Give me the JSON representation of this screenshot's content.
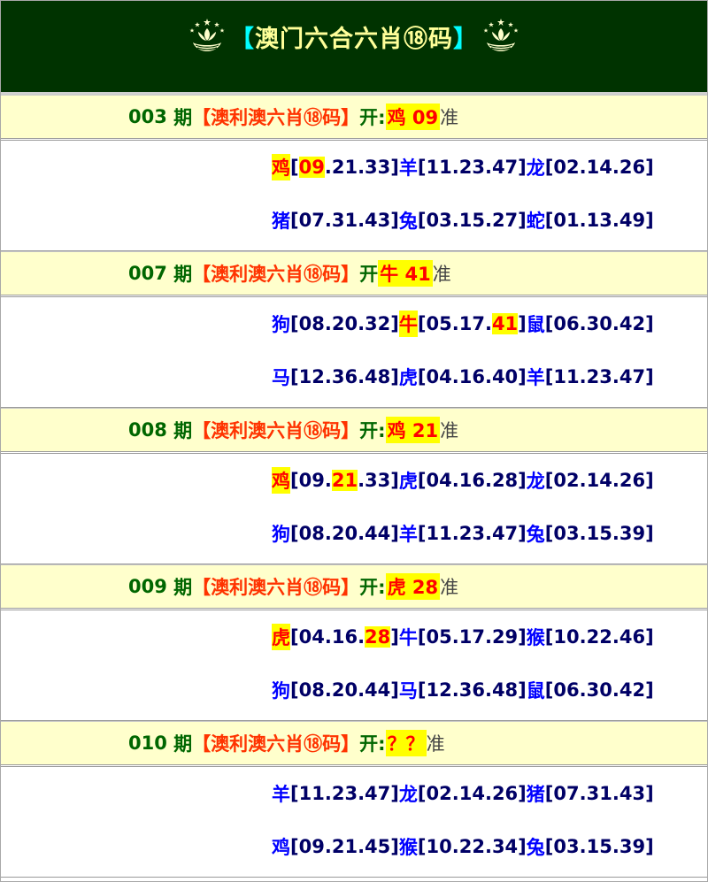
{
  "header": {
    "title_left": "【",
    "title_text": "澳门六合六肖⑱码",
    "title_right": "】"
  },
  "issues": [
    {
      "number": "003",
      "period_label": "期",
      "name": "【澳利澳六肖⑱码】",
      "open_label": "开:",
      "result": "鸡 09",
      "accuracy": "准",
      "lines": [
        [
          {
            "zodiac": "鸡",
            "zhl": true,
            "nums": [
              "09",
              "21",
              "33"
            ],
            "hl": [
              0
            ]
          },
          {
            "zodiac": "羊",
            "zhl": false,
            "nums": [
              "11",
              "23",
              "47"
            ],
            "hl": []
          },
          {
            "zodiac": "龙",
            "zhl": false,
            "nums": [
              "02",
              "14",
              "26"
            ],
            "hl": []
          }
        ],
        [
          {
            "zodiac": "猪",
            "zhl": false,
            "nums": [
              "07",
              "31",
              "43"
            ],
            "hl": []
          },
          {
            "zodiac": "兔",
            "zhl": false,
            "nums": [
              "03",
              "15",
              "27"
            ],
            "hl": []
          },
          {
            "zodiac": "蛇",
            "zhl": false,
            "nums": [
              "01",
              "13",
              "49"
            ],
            "hl": []
          }
        ]
      ]
    },
    {
      "number": "007",
      "period_label": "期",
      "name": "【澳利澳六肖⑱码】",
      "open_label": "开",
      "result": "牛 41",
      "accuracy": "准",
      "lines": [
        [
          {
            "zodiac": "狗",
            "zhl": false,
            "nums": [
              "08",
              "20",
              "32"
            ],
            "hl": []
          },
          {
            "zodiac": "牛",
            "zhl": true,
            "nums": [
              "05",
              "17",
              "41"
            ],
            "hl": [
              2
            ]
          },
          {
            "zodiac": "鼠",
            "zhl": false,
            "nums": [
              "06",
              "30",
              "42"
            ],
            "hl": []
          }
        ],
        [
          {
            "zodiac": "马",
            "zhl": false,
            "nums": [
              "12",
              "36",
              "48"
            ],
            "hl": []
          },
          {
            "zodiac": "虎",
            "zhl": false,
            "nums": [
              "04",
              "16",
              "40"
            ],
            "hl": []
          },
          {
            "zodiac": "羊",
            "zhl": false,
            "nums": [
              "11",
              "23",
              "47"
            ],
            "hl": []
          }
        ]
      ]
    },
    {
      "number": "008",
      "period_label": "期",
      "name": "【澳利澳六肖⑱码】",
      "open_label": "开:",
      "result": "鸡 21",
      "accuracy": "准",
      "lines": [
        [
          {
            "zodiac": "鸡",
            "zhl": true,
            "nums": [
              "09",
              "21",
              "33"
            ],
            "hl": [
              1
            ]
          },
          {
            "zodiac": "虎",
            "zhl": false,
            "nums": [
              "04",
              "16",
              "28"
            ],
            "hl": []
          },
          {
            "zodiac": "龙",
            "zhl": false,
            "nums": [
              "02",
              "14",
              "26"
            ],
            "hl": []
          }
        ],
        [
          {
            "zodiac": "狗",
            "zhl": false,
            "nums": [
              "08",
              "20",
              "44"
            ],
            "hl": []
          },
          {
            "zodiac": "羊",
            "zhl": false,
            "nums": [
              "11",
              "23",
              "47"
            ],
            "hl": []
          },
          {
            "zodiac": "兔",
            "zhl": false,
            "nums": [
              "03",
              "15",
              "39"
            ],
            "hl": []
          }
        ]
      ]
    },
    {
      "number": "009",
      "period_label": "期",
      "name": "【澳利澳六肖⑱码】",
      "open_label": "开:",
      "result": "虎 28",
      "accuracy": "准",
      "lines": [
        [
          {
            "zodiac": "虎",
            "zhl": true,
            "nums": [
              "04",
              "16",
              "28"
            ],
            "hl": [
              2
            ]
          },
          {
            "zodiac": "牛",
            "zhl": false,
            "nums": [
              "05",
              "17",
              "29"
            ],
            "hl": []
          },
          {
            "zodiac": "猴",
            "zhl": false,
            "nums": [
              "10",
              "22",
              "46"
            ],
            "hl": []
          }
        ],
        [
          {
            "zodiac": "狗",
            "zhl": false,
            "nums": [
              "08",
              "20",
              "44"
            ],
            "hl": []
          },
          {
            "zodiac": "马",
            "zhl": false,
            "nums": [
              "12",
              "36",
              "48"
            ],
            "hl": []
          },
          {
            "zodiac": "鼠",
            "zhl": false,
            "nums": [
              "06",
              "30",
              "42"
            ],
            "hl": []
          }
        ]
      ]
    },
    {
      "number": "010",
      "period_label": "期",
      "name": "【澳利澳六肖⑱码】",
      "open_label": "开:",
      "result": "？？",
      "accuracy": "准",
      "lines": [
        [
          {
            "zodiac": "羊",
            "zhl": false,
            "nums": [
              "11",
              "23",
              "47"
            ],
            "hl": []
          },
          {
            "zodiac": "龙",
            "zhl": false,
            "nums": [
              "02",
              "14",
              "26"
            ],
            "hl": []
          },
          {
            "zodiac": "猪",
            "zhl": false,
            "nums": [
              "07",
              "31",
              "43"
            ],
            "hl": []
          }
        ],
        [
          {
            "zodiac": "鸡",
            "zhl": false,
            "nums": [
              "09",
              "21",
              "45"
            ],
            "hl": []
          },
          {
            "zodiac": "猴",
            "zhl": false,
            "nums": [
              "10",
              "22",
              "34"
            ],
            "hl": []
          },
          {
            "zodiac": "兔",
            "zhl": false,
            "nums": [
              "03",
              "15",
              "39"
            ],
            "hl": []
          }
        ]
      ]
    }
  ],
  "colors": {
    "header_bg": "#003300",
    "title": "#ffff99",
    "bracket": "#00ffff",
    "issue_bg": "#ffffcc",
    "issue_no": "#006600",
    "name": "#ff3300",
    "highlight_bg": "#ffff00",
    "highlight_text": "#ff0000",
    "zodiac": "#0000ff",
    "numbers": "#000066"
  },
  "icons": {
    "emblem": "macau-lotus-emblem-icon"
  }
}
